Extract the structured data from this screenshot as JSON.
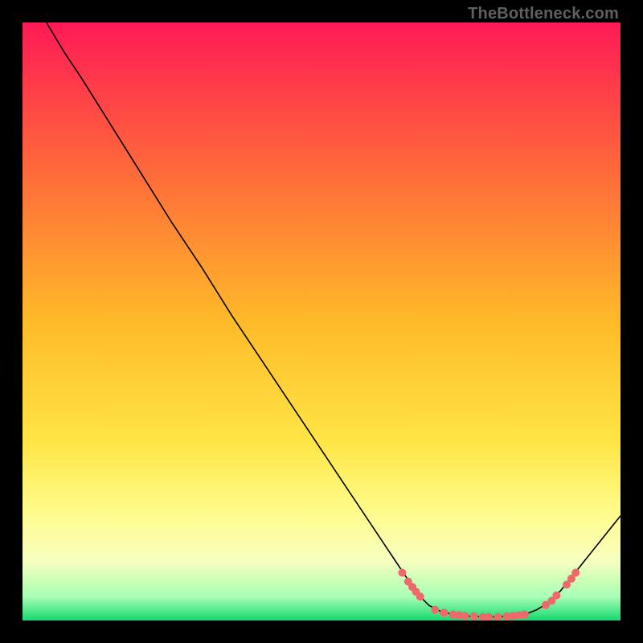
{
  "watermark": "TheBottleneck.com",
  "chart_data": {
    "type": "line",
    "title": "",
    "xlabel": "",
    "ylabel": "",
    "xlim": [
      0,
      100
    ],
    "ylim": [
      0,
      100
    ],
    "background_gradient_stops": [
      {
        "offset": 0,
        "color": "#ff1a55"
      },
      {
        "offset": 25,
        "color": "#ff6a3a"
      },
      {
        "offset": 50,
        "color": "#ffba29"
      },
      {
        "offset": 70,
        "color": "#ffe545"
      },
      {
        "offset": 82,
        "color": "#fffc8c"
      },
      {
        "offset": 90,
        "color": "#f7ffc0"
      },
      {
        "offset": 96,
        "color": "#a8ffb4"
      },
      {
        "offset": 100,
        "color": "#15d96f"
      }
    ],
    "curve": [
      {
        "x": 4.0,
        "y": 100.0
      },
      {
        "x": 7.0,
        "y": 95.0
      },
      {
        "x": 10.0,
        "y": 90.5
      },
      {
        "x": 15.0,
        "y": 82.5
      },
      {
        "x": 20.0,
        "y": 74.5
      },
      {
        "x": 25.0,
        "y": 66.5
      },
      {
        "x": 30.0,
        "y": 59.0
      },
      {
        "x": 35.0,
        "y": 51.0
      },
      {
        "x": 40.0,
        "y": 43.5
      },
      {
        "x": 45.0,
        "y": 36.0
      },
      {
        "x": 50.0,
        "y": 28.5
      },
      {
        "x": 55.0,
        "y": 21.0
      },
      {
        "x": 60.0,
        "y": 13.5
      },
      {
        "x": 62.0,
        "y": 10.5
      },
      {
        "x": 64.0,
        "y": 7.5
      },
      {
        "x": 65.0,
        "y": 6.0
      },
      {
        "x": 66.5,
        "y": 4.0
      },
      {
        "x": 68.0,
        "y": 2.5
      },
      {
        "x": 70.0,
        "y": 1.5
      },
      {
        "x": 72.0,
        "y": 1.0
      },
      {
        "x": 75.0,
        "y": 0.7
      },
      {
        "x": 78.0,
        "y": 0.6
      },
      {
        "x": 81.0,
        "y": 0.7
      },
      {
        "x": 84.0,
        "y": 1.0
      },
      {
        "x": 86.0,
        "y": 1.8
      },
      {
        "x": 88.0,
        "y": 3.0
      },
      {
        "x": 90.0,
        "y": 5.0
      },
      {
        "x": 92.0,
        "y": 7.5
      },
      {
        "x": 94.0,
        "y": 10.0
      },
      {
        "x": 96.0,
        "y": 12.5
      },
      {
        "x": 98.0,
        "y": 15.0
      },
      {
        "x": 100.0,
        "y": 17.5
      }
    ],
    "markers": [
      {
        "x": 63.5,
        "y": 8.0
      },
      {
        "x": 64.5,
        "y": 6.5
      },
      {
        "x": 65.2,
        "y": 5.6
      },
      {
        "x": 65.8,
        "y": 4.8
      },
      {
        "x": 66.5,
        "y": 4.0
      },
      {
        "x": 69.0,
        "y": 1.8
      },
      {
        "x": 70.5,
        "y": 1.3
      },
      {
        "x": 72.0,
        "y": 1.0
      },
      {
        "x": 73.0,
        "y": 0.9
      },
      {
        "x": 74.0,
        "y": 0.8
      },
      {
        "x": 75.5,
        "y": 0.7
      },
      {
        "x": 77.0,
        "y": 0.6
      },
      {
        "x": 78.0,
        "y": 0.6
      },
      {
        "x": 79.5,
        "y": 0.6
      },
      {
        "x": 81.0,
        "y": 0.7
      },
      {
        "x": 82.0,
        "y": 0.8
      },
      {
        "x": 83.0,
        "y": 0.9
      },
      {
        "x": 84.0,
        "y": 1.0
      },
      {
        "x": 87.5,
        "y": 2.6
      },
      {
        "x": 88.5,
        "y": 3.3
      },
      {
        "x": 89.3,
        "y": 4.2
      },
      {
        "x": 91.0,
        "y": 6.0
      },
      {
        "x": 91.8,
        "y": 7.0
      },
      {
        "x": 92.5,
        "y": 8.0
      }
    ],
    "marker_color": "#ee6a6a",
    "line_color": "#000000"
  }
}
